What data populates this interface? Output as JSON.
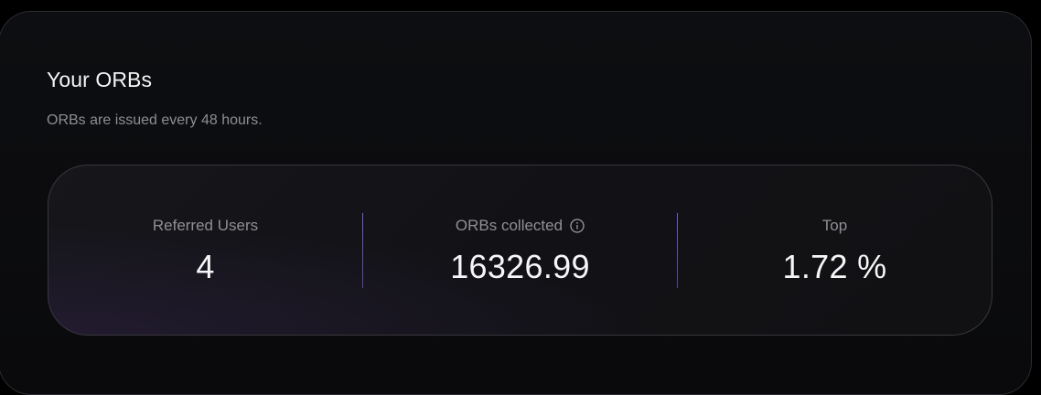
{
  "header": {
    "title": "Your ORBs",
    "subtitle": "ORBs are issued every 48 hours."
  },
  "stats": [
    {
      "label": "Referred Users",
      "value": "4"
    },
    {
      "label": "ORBs collected",
      "value": "16326.99",
      "icon": "info-icon"
    },
    {
      "label": "Top",
      "value": "1.72 %"
    }
  ],
  "colors": {
    "background": "#000000",
    "panel": "#0b0b0d",
    "card": "#141418",
    "divider_accent": "#6e4fc4",
    "text_primary": "#f6f6f8",
    "text_secondary": "#8f9094"
  }
}
